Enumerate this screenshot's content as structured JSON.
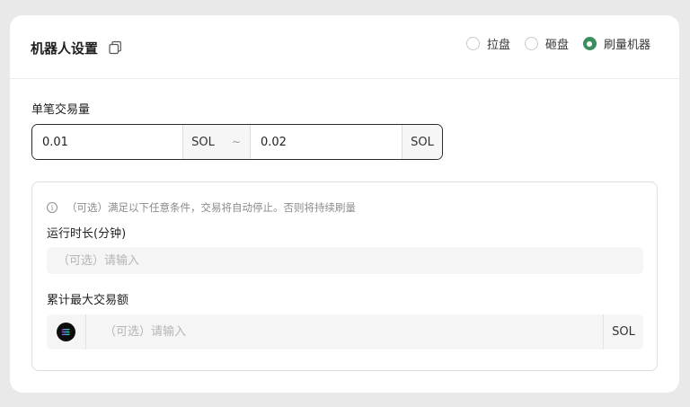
{
  "header": {
    "title": "机器人设置",
    "copy_icon": "copy-icon",
    "modes": [
      {
        "label": "拉盘",
        "checked": false
      },
      {
        "label": "砸盘",
        "checked": false
      },
      {
        "label": "刷量机器",
        "checked": true
      }
    ]
  },
  "trade_amount": {
    "label": "单笔交易量",
    "min_value": "0.01",
    "max_value": "0.02",
    "separator": "~",
    "unit": "SOL"
  },
  "conditions": {
    "info_icon": "info-icon",
    "info_text": "（可选）满足以下任意条件，交易将自动停止。否则将持续刷量",
    "runtime": {
      "label": "运行时长(分钟)",
      "placeholder": "（可选）请输入"
    },
    "max_volume": {
      "label": "累计最大交易额",
      "placeholder": "（可选）请输入",
      "unit": "SOL",
      "token_icon": "solana-icon"
    }
  },
  "colors": {
    "accent": "#3b8f5f",
    "background": "#e9e9ea",
    "card": "#ffffff"
  }
}
